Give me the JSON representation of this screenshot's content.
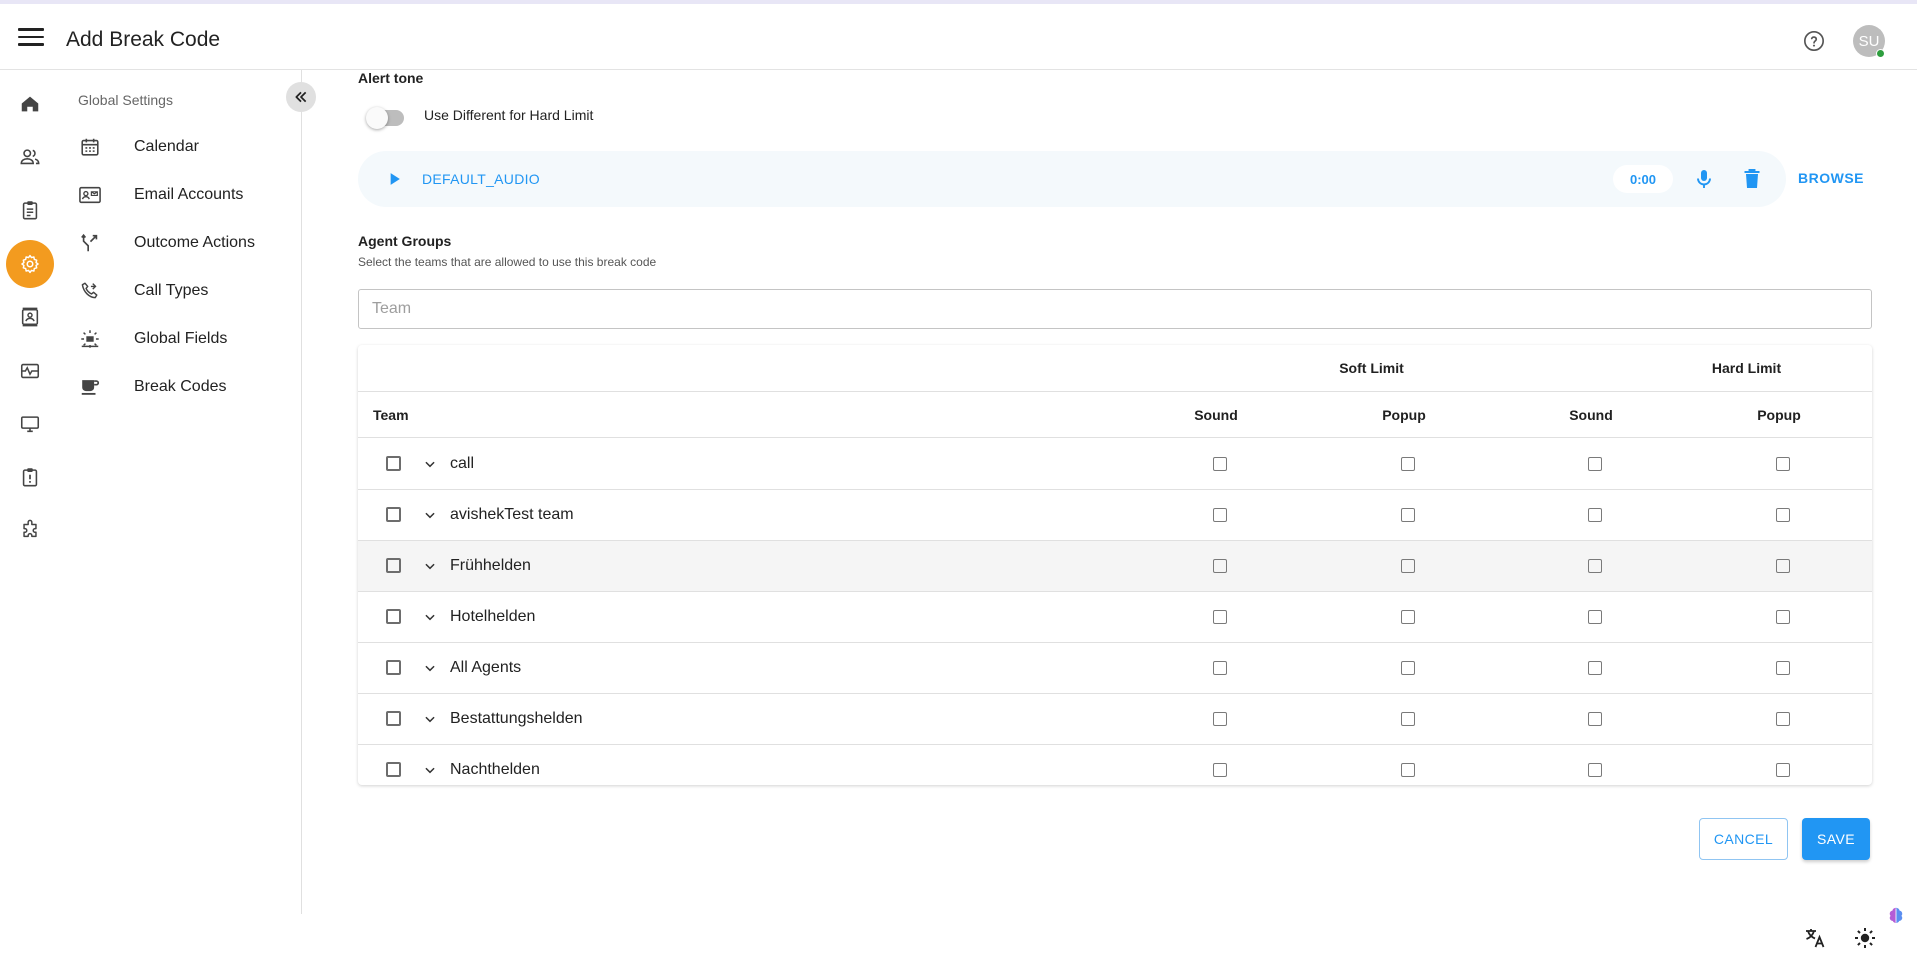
{
  "header": {
    "title": "Add Break Code",
    "avatar_initials": "SU"
  },
  "rail": {
    "items": [
      {
        "icon": "home-icon"
      },
      {
        "icon": "people-icon"
      },
      {
        "icon": "clipboard-icon"
      },
      {
        "icon": "settings-icon",
        "active": true
      },
      {
        "icon": "contact-card-icon"
      },
      {
        "icon": "monitor-heart-icon"
      },
      {
        "icon": "desktop-icon"
      },
      {
        "icon": "alert-report-icon"
      },
      {
        "icon": "puzzle-icon"
      }
    ],
    "active_color": "#f39b1f"
  },
  "subnav": {
    "title": "Global Settings",
    "items": [
      {
        "label": "Calendar",
        "icon": "calendar-icon"
      },
      {
        "label": "Email Accounts",
        "icon": "contact-mail-icon"
      },
      {
        "label": "Outcome Actions",
        "icon": "call-split-icon"
      },
      {
        "label": "Call Types",
        "icon": "phone-forward-icon"
      },
      {
        "label": "Global Fields",
        "icon": "global-fields-icon"
      },
      {
        "label": "Break Codes",
        "icon": "coffee-icon"
      }
    ]
  },
  "alert": {
    "label": "Alert tone",
    "toggle_label": "Use Different for Hard Limit",
    "toggle_on": false,
    "audio_name": "DEFAULT_AUDIO",
    "audio_time": "0:00",
    "browse_label": "BROWSE"
  },
  "agent_groups": {
    "label": "Agent Groups",
    "helper": "Select the teams that are allowed to use this break code",
    "search_placeholder": "Team"
  },
  "table": {
    "soft_limit": "Soft Limit",
    "hard_limit": "Hard Limit",
    "col_team": "Team",
    "col_sound": "Sound",
    "col_popup": "Popup",
    "rows": [
      {
        "name": "call"
      },
      {
        "name": "avishekTest team"
      },
      {
        "name": "Frühhelden"
      },
      {
        "name": "Hotelhelden"
      },
      {
        "name": "All Agents"
      },
      {
        "name": "Bestattungshelden"
      },
      {
        "name": "Nachthelden"
      }
    ]
  },
  "actions": {
    "cancel": "CANCEL",
    "save": "SAVE"
  },
  "colors": {
    "primary": "#2196f3",
    "accent": "#f39b1f"
  }
}
